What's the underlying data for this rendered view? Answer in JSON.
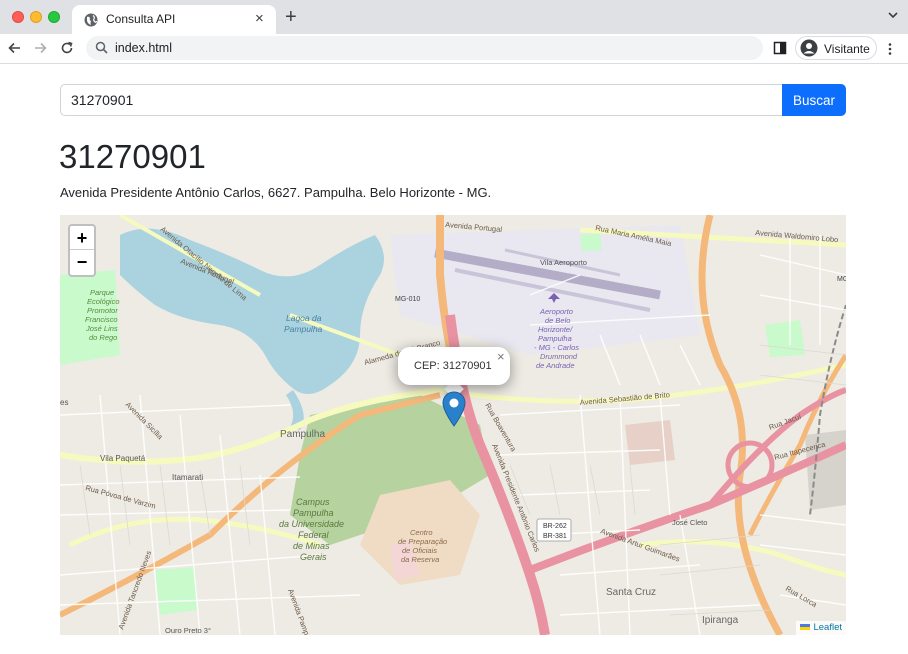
{
  "browser": {
    "tab_title": "Consulta API",
    "tab_close": "×",
    "new_tab": "+",
    "url": "index.html",
    "profile_label": "Visitante"
  },
  "search": {
    "value": "31270901",
    "button_label": "Buscar"
  },
  "result": {
    "title": "31270901",
    "address": "Avenida Presidente Antônio Carlos, 6627. Pampulha. Belo Horizonte - MG."
  },
  "map": {
    "zoom_in": "+",
    "zoom_out": "−",
    "popup_text": "CEP: 31270901",
    "popup_close": "×",
    "attribution": "Leaflet",
    "labels": {
      "av_portugal_top": "Avenida Portugal",
      "av_portugal_mid": "Avenida Portugal",
      "av_otacilio": "Avenida Otacílio Negrão de Lima",
      "rua_maria_amelia": "Rua Maria Amélia Maia",
      "av_waldomiro": "Avenida Waldomiro Lobo",
      "vila_aeroporto": "Vila Aeroporto",
      "mg010": "MG-010",
      "mg_edge": "MG",
      "parque_1": "Parque",
      "parque_2": "Ecológico",
      "parque_3": "Promotor",
      "parque_4": "Francisco",
      "parque_5": "José Lins",
      "parque_6": "do Rego",
      "lagoa_1": "Lagoa da",
      "lagoa_2": "Pampulha",
      "aero_1": "Aeroporto",
      "aero_2": "de Belo",
      "aero_3": "Horizonte/",
      "aero_4": "Pampulha",
      "aero_5": "- MG - Carlos",
      "aero_6": "Drummond",
      "aero_7": "de Andrade",
      "alameda": "Alameda do Ipê Branco",
      "rua_boaventura": "Rua Boaventura",
      "av_sebastiao": "Avenida Sebastião de Brito",
      "av_sicilia": "Avenida Sicília",
      "es": "es",
      "pampulha": "Pampulha",
      "vila_paqueta": "Vila Paquetá",
      "itamarati": "Itamarati",
      "rua_povoa": "Rua Póvoa de Varzim",
      "campus_1": "Campus",
      "campus_2": "Pampulha",
      "campus_3": "da Universidade",
      "campus_4": "Federal",
      "campus_5": "de Minas",
      "campus_6": "Gerais",
      "centro_1": "Centro",
      "centro_2": "de Preparação",
      "centro_3": "de Oficiais",
      "centro_4": "da Reserva",
      "av_pres_antonio": "Avenida Presidente Antônio Carlos",
      "br262": "BR-262",
      "br381": "BR-381",
      "av_artur": "Avenida Artur Guimarães",
      "jose_cleto": "José Cleto",
      "rua_jacui": "Rua Jacuí",
      "rua_itapecerica": "Rua Itapecerica",
      "rua_lorca": "Rua Lorca",
      "santa_cruz": "Santa Cruz",
      "ipiranga": "Ipiranga",
      "av_tancredo": "Avenida Tancredo Neves",
      "ouro_preto": "Ouro Preto 3°",
      "av_pampulha_b": "Avenida Pampulha"
    }
  },
  "colors": {
    "accent": "#0d6efd",
    "water": "#aad3df",
    "park": "#c8facc",
    "campus": "#b5d29f",
    "motorway": "#e892a2",
    "primary_road": "#f4b87a",
    "secondary_road": "#f7fabf",
    "marker": "#2a81cb"
  }
}
